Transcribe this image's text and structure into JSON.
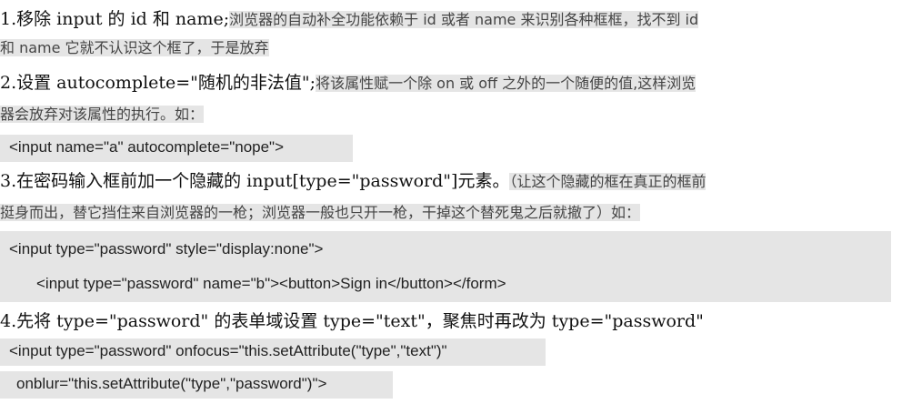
{
  "item1": {
    "heading": "1.移除 input 的 id 和 name;",
    "note_a": "浏览器的自动补全功能依赖于 id 或者 name 来识别各种框框，找不到 id",
    "note_b": "和 name 它就不认识这个框了，于是放弃"
  },
  "item2": {
    "heading": "2.设置 autocomplete=\"随机的非法值\";",
    "note_a": "将该属性赋一个除 on  或  off 之外的一个随便的值,这样浏览",
    "note_b": "器会放弃对该属性的执行。如：",
    "code": "<input name=\"a\" autocomplete=\"nope\">"
  },
  "item3": {
    "heading": "3.在密码输入框前加一个隐藏的 input[type=\"password\"]元素。",
    "note_a": "（让这个隐藏的框在真正的框前",
    "note_b": "挺身而出，替它挡住来自浏览器的一枪；浏览器一般也只开一枪，干掉这个替死鬼之后就撤了）如：",
    "code_a": "<input type=\"password\" style=\"display:none\">",
    "code_b": "<input type=\"password\" name=\"b\"><button>Sign in</button></form>"
  },
  "item4": {
    "heading": "4.先将 type=\"password\" 的表单域设置 type=\"text\"，聚焦时再改为 type=\"password\"",
    "code_a": "<input type=\"password\" onfocus=\"this.setAttribute(\"type\",\"text\")\"",
    "code_b": "onblur=\"this.setAttribute(\"type\",\"password\")\">"
  }
}
